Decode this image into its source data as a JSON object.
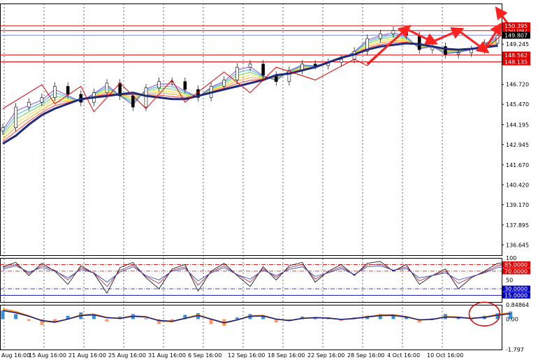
{
  "chart_data": [
    {
      "type": "line",
      "panel": "price",
      "ylim": [
        136.0,
        151.8
      ],
      "yticks": [
        "150.097",
        "150.395",
        "149.807",
        "149.245",
        "148.562",
        "148.135",
        "146.720",
        "145.470",
        "144.195",
        "142.945",
        "141.670",
        "140.420",
        "139.170",
        "137.895",
        "136.645"
      ],
      "price_levels": [
        {
          "label": "150.097",
          "style": "red-box"
        },
        {
          "label": "150.395",
          "style": "red-box"
        },
        {
          "label": "149.807",
          "style": "black-box"
        },
        {
          "label": "148.562",
          "style": "red-box"
        },
        {
          "label": "148.135",
          "style": "red-box"
        }
      ],
      "horizontal_lines": [
        {
          "value": 150.097,
          "color": "#e00000"
        },
        {
          "value": 150.395,
          "color": "#e00000"
        },
        {
          "value": 149.807,
          "color": "#7f8fd8"
        },
        {
          "value": 148.562,
          "color": "#e00000"
        },
        {
          "value": 148.135,
          "color": "#e00000"
        }
      ],
      "series": [
        {
          "role": "moving_average",
          "color": "#1e2a7a",
          "values": [
            143.0,
            143.5,
            144.2,
            144.8,
            145.2,
            145.5,
            145.8,
            145.9,
            146.0,
            146.1,
            146.2,
            146.0,
            145.9,
            145.8,
            145.8,
            146.0,
            146.2,
            146.4,
            146.6,
            146.8,
            147.0,
            147.3,
            147.4,
            147.6,
            147.8,
            148.1,
            148.4,
            148.6,
            148.9,
            149.1,
            149.2,
            149.3,
            149.25,
            149.1,
            148.95,
            148.9,
            148.95,
            149.05,
            149.15
          ]
        },
        {
          "role": "price",
          "color": "#2e2e2e",
          "values": [
            144.0,
            145.3,
            145.6,
            145.9,
            146.6,
            146.1,
            145.6,
            146.2,
            146.8,
            146.0,
            145.3,
            146.5,
            146.9,
            146.9,
            146.4,
            145.9,
            146.6,
            147.0,
            147.8,
            148.0,
            147.3,
            146.9,
            147.6,
            148.0,
            147.9,
            148.1,
            148.3,
            148.8,
            149.6,
            149.9,
            150.1,
            149.8,
            148.9,
            149.1,
            148.6,
            148.7,
            148.9,
            149.3,
            149.8
          ]
        }
      ],
      "zigzag": [
        [
          0,
          145.2
        ],
        [
          3,
          146.7
        ],
        [
          4,
          145.5
        ],
        [
          6,
          146.6
        ],
        [
          7,
          145.0
        ],
        [
          9,
          146.8
        ],
        [
          11,
          145.2
        ],
        [
          13,
          147.0
        ],
        [
          14,
          145.6
        ],
        [
          17,
          147.5
        ],
        [
          19,
          146.2
        ],
        [
          21,
          147.8
        ],
        [
          24,
          147.0
        ],
        [
          27,
          148.3
        ],
        [
          28,
          147.9
        ],
        [
          31,
          150.2
        ],
        [
          33,
          149.4
        ],
        [
          35,
          150.1
        ],
        [
          37,
          148.9
        ],
        [
          39,
          150.3
        ]
      ],
      "arrows": [
        [
          28,
          148.0,
          31,
          150.2
        ],
        [
          31,
          150.2,
          33,
          149.4
        ],
        [
          33,
          149.4,
          35,
          150.1
        ],
        [
          35,
          150.1,
          37,
          148.9
        ],
        [
          37,
          148.9,
          39,
          150.3
        ],
        [
          39,
          150.3,
          40,
          151.3
        ]
      ]
    },
    {
      "type": "line",
      "panel": "oscillator",
      "ylim": [
        0,
        100
      ],
      "yticks": [
        "100",
        "85.0000",
        "70.0000",
        "50",
        "30.0000",
        "15.0000"
      ],
      "levels": [
        {
          "value": 85,
          "label": "85.0000",
          "color": "#e00000",
          "dash": "dashdot"
        },
        {
          "value": 70,
          "label": "70.0000",
          "color": "#e00000",
          "dash": "dashdot"
        },
        {
          "value": 30,
          "label": "30.0000",
          "color": "#0000c8",
          "dash": "dashdot"
        },
        {
          "value": 15,
          "label": "15.0000",
          "color": "#0000c8",
          "dash": "solid"
        }
      ],
      "series": [
        {
          "color": "#000000",
          "values": [
            80,
            90,
            60,
            88,
            70,
            40,
            82,
            65,
            20,
            78,
            90,
            55,
            30,
            75,
            85,
            25,
            70,
            88,
            60,
            35,
            80,
            50,
            82,
            90,
            45,
            70,
            85,
            60,
            88,
            92,
            70,
            85,
            40,
            60,
            75,
            30,
            55,
            70,
            88,
            90
          ]
        },
        {
          "color": "#a02040",
          "values": [
            78,
            85,
            65,
            82,
            72,
            50,
            78,
            66,
            35,
            72,
            84,
            58,
            42,
            72,
            80,
            38,
            68,
            82,
            62,
            45,
            76,
            56,
            78,
            85,
            52,
            68,
            80,
            62,
            84,
            86,
            72,
            80,
            48,
            60,
            70,
            42,
            56,
            68,
            82,
            84
          ]
        },
        {
          "color": "#2040c0",
          "values": [
            75,
            82,
            68,
            78,
            70,
            55,
            74,
            66,
            45,
            68,
            80,
            60,
            50,
            70,
            76,
            48,
            66,
            78,
            62,
            52,
            72,
            60,
            74,
            80,
            58,
            66,
            76,
            62,
            80,
            82,
            72,
            76,
            55,
            60,
            66,
            50,
            58,
            66,
            78,
            80
          ]
        }
      ]
    },
    {
      "type": "bar",
      "panel": "histogram",
      "ylim": [
        -1.797,
        0.84864
      ],
      "yticks": [
        "0.84864",
        "0.00",
        "-1.797"
      ],
      "values": [
        0.5,
        0.3,
        -0.1,
        -0.35,
        -0.2,
        0.2,
        0.4,
        0.3,
        -0.15,
        0.15,
        0.3,
        0.05,
        -0.3,
        -0.1,
        0.25,
        0.35,
        -0.3,
        -0.4,
        0.1,
        0.3,
        0.2,
        -0.2,
        -0.1,
        0.15,
        0.1,
        0.05,
        -0.1,
        0.1,
        0.2,
        0.3,
        0.25,
        0.1,
        -0.2,
        0.05,
        0.3,
        0.1,
        0.0,
        0.2,
        0.35,
        0.45
      ],
      "signal": [
        0.6,
        0.45,
        0.2,
        -0.1,
        -0.2,
        0.0,
        0.25,
        0.3,
        0.1,
        0.05,
        0.2,
        0.15,
        -0.1,
        -0.15,
        0.05,
        0.25,
        0.0,
        -0.25,
        -0.05,
        0.2,
        0.22,
        0.0,
        -0.1,
        0.05,
        0.1,
        0.07,
        -0.02,
        0.04,
        0.15,
        0.25,
        0.26,
        0.15,
        -0.05,
        -0.02,
        0.15,
        0.12,
        0.05,
        0.12,
        0.28,
        0.38
      ],
      "highlight_circle": true
    }
  ],
  "xaxis": {
    "labels": [
      "Aug 16:00",
      "15 Aug 16:00",
      "21 Aug 16:00",
      "25 Aug 16:00",
      "31 Aug 16:00",
      "6 Sep 16:00",
      "12 Sep 16:00",
      "18 Sep 16:00",
      "22 Sep 16:00",
      "28 Sep 16:00",
      "4 Oct 16:00",
      "10 Oct 16:00"
    ]
  },
  "colors": {
    "zigzag": "#e00000",
    "arrow": "#ff2020",
    "ribbon": [
      "#ff3b3b",
      "#ff9f2a",
      "#f2e02a",
      "#6ad24e",
      "#3ab0e8",
      "#8a4fd8"
    ],
    "histogram_positive": "#3a8fd8",
    "histogram_negative": "#ff9a6e",
    "signal_line": "#ff8c00",
    "signal_line_2": "#1a1a7a"
  }
}
